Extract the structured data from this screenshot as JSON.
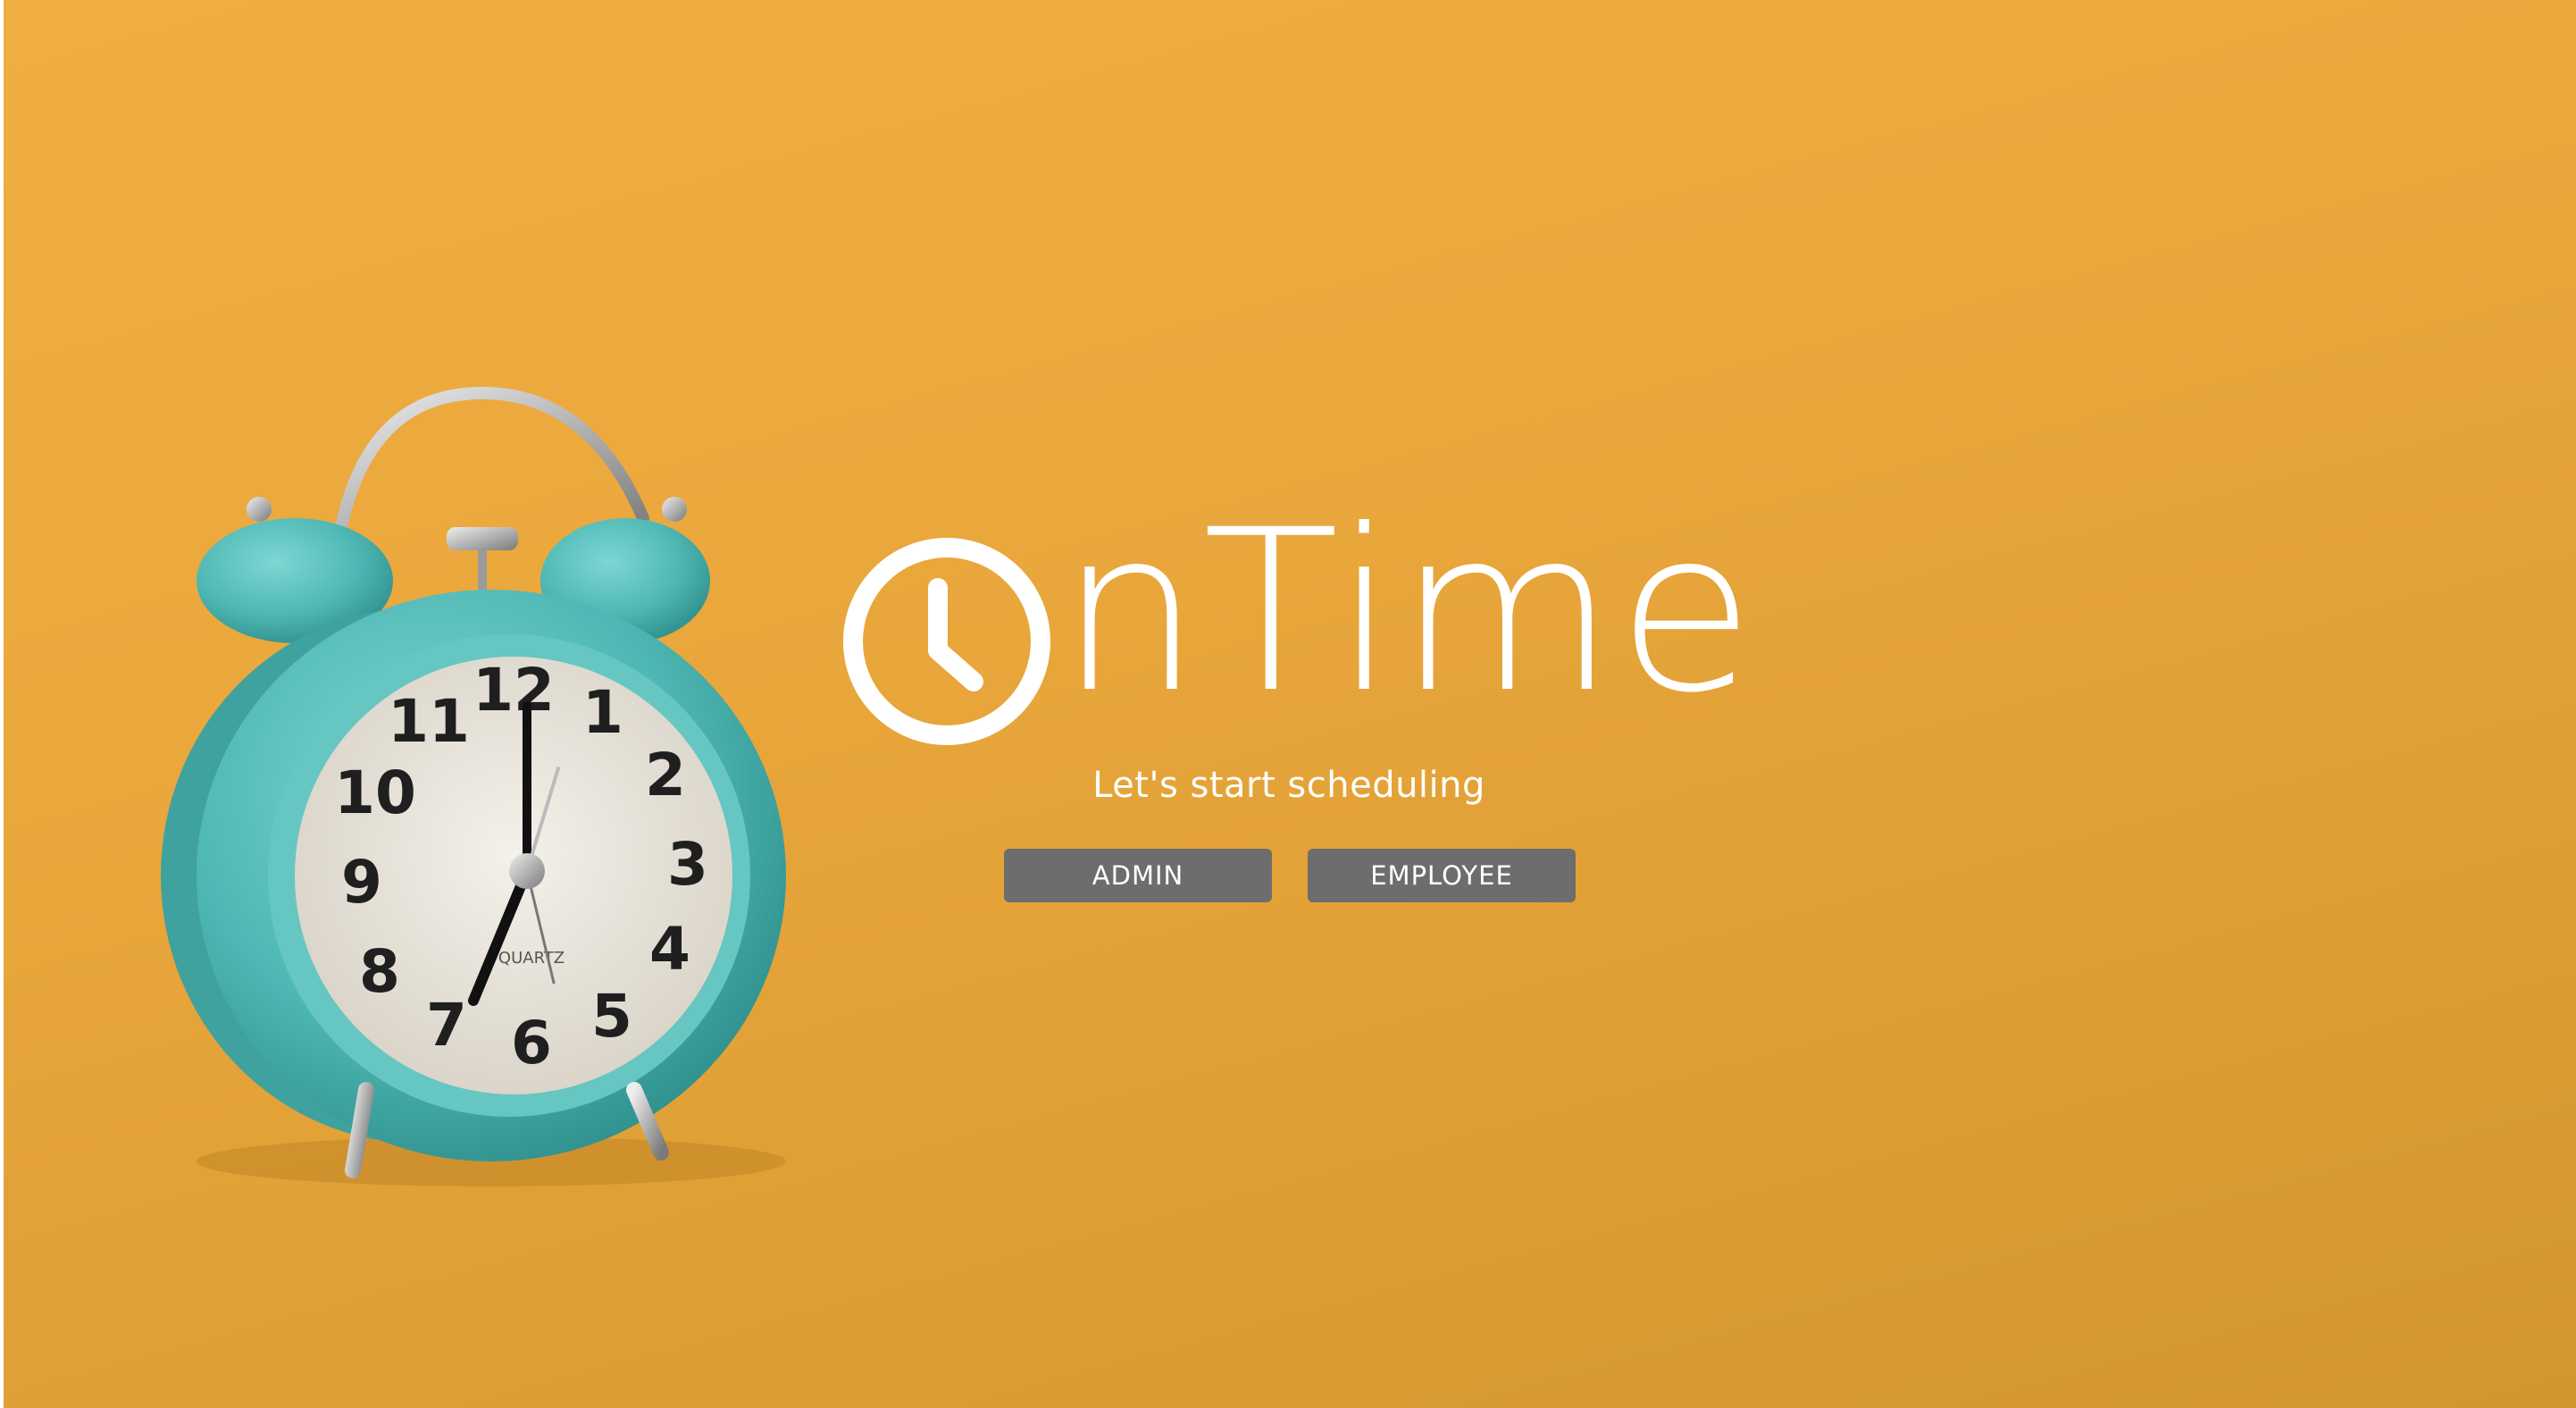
{
  "brand": {
    "name": "OnTime",
    "logo_letters": "nTime",
    "tagline": "Let's start scheduling"
  },
  "actions": {
    "admin_label": "ADMIN",
    "employee_label": "EMPLOYEE"
  },
  "clock_photo": {
    "dial_numbers": [
      "12",
      "1",
      "2",
      "3",
      "4",
      "5",
      "6",
      "7",
      "8",
      "9",
      "10",
      "11"
    ],
    "dial_brand": "QUARTZ"
  },
  "colors": {
    "background": "#eba83d",
    "button": "#6d6d6d",
    "text": "#ffffff",
    "clock_body": "#4fb8b4"
  },
  "icons": [
    "clock-logo-icon",
    "alarm-clock-illustration"
  ]
}
